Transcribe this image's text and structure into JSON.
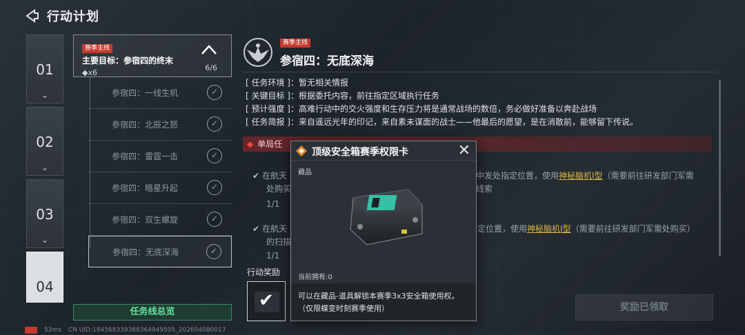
{
  "header": {
    "title": "行动计划"
  },
  "chapters": [
    {
      "num": "01",
      "chev": "⌄"
    },
    {
      "num": "02",
      "chev": "⌄"
    },
    {
      "num": "03",
      "chev": "⌄"
    },
    {
      "num": "04"
    }
  ],
  "main_target": {
    "tag": "赛季主线",
    "title": "主要目标：参宿四的终末",
    "reward": "◆x6",
    "progress": "6/6"
  },
  "sub_missions": [
    {
      "label": "参宿四：一线生机"
    },
    {
      "label": "参宿四：北辰之怒"
    },
    {
      "label": "参宿四：雷霆一击"
    },
    {
      "label": "参宿四：暗星升起"
    },
    {
      "label": "参宿四：双生螺旋"
    },
    {
      "label": "参宿四：无底深海"
    }
  ],
  "overview_button": "任务线总览",
  "detail": {
    "tag": "赛季主线",
    "title": "参宿四：无底深海",
    "env": "[ 任务环境 ]：暂无相关情报",
    "target": "[ 关键目标 ]：根据委托内容，前往指定区域执行任务",
    "intensity": "[ 预计强度 ]：高难行动中的交火强度和生存压力将是通常战场的数倍，务必做好准备以奔赴战场",
    "brief": "[ 任务简报 ]：来自遥远光年的印记，来自素未谋面的战士——他最后的愿望，是在消散前，能够留下传说。",
    "warning": "单局任",
    "task1_a": "在航天",
    "task1_b": "中发处指定位置，使用",
    "task1_link": "神秘脑机Ⅰ型",
    "task1_c": "（需要前往研发部门军需",
    "task1_d": "处购买",
    "task1_e": "线索",
    "task1_count": "1/1",
    "task2_a": "在航天",
    "task2_b": "定位置，使用",
    "task2_link": "神秘脑机Ⅰ型",
    "task2_c": "（需要前往研发部门军需处购买）",
    "task2_d": "的扫描",
    "task2_count": "1/1",
    "reward_label": "行动奖励",
    "claimed": "奖励已领取"
  },
  "popup": {
    "title": "顶级安全箱赛季权限卡",
    "category": "藏品",
    "owned": "当前拥有:0",
    "desc": "可以在藏品-道具解锁本赛季3x3安全箱使用权。（仅限蝶变时刻赛季使用）"
  },
  "footer": {
    "ping": "52ms",
    "uid": "CN UID:18456833938836494950​5_202604080017"
  },
  "colors": {
    "accent_green": "#61e398",
    "season_red": "#c33b2e",
    "link_gold": "#d8b44a"
  }
}
